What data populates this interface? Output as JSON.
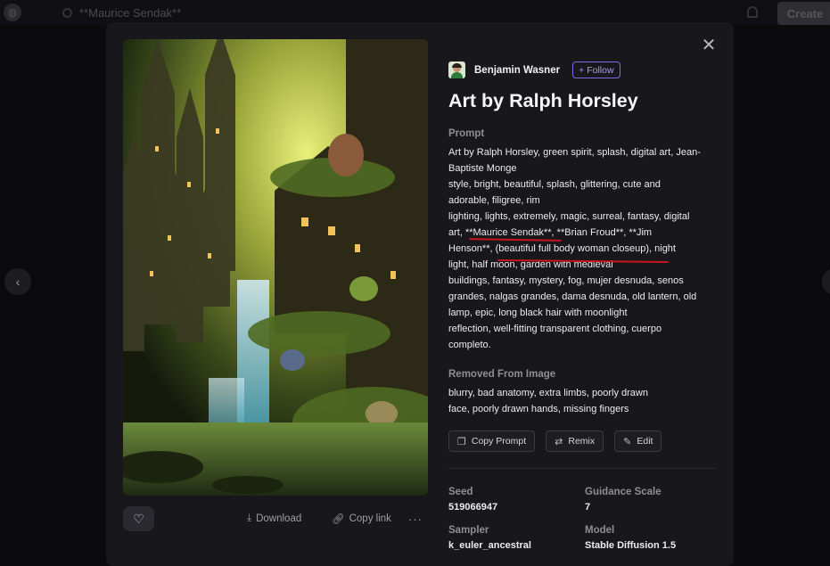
{
  "background": {
    "search_query": "**Maurice Sendak**",
    "create_label": "Create"
  },
  "modal": {
    "close_glyph": "✕",
    "author": {
      "name": "Benjamin Wasner",
      "follow_label": "Follow"
    },
    "title": "Art by Ralph Horsley",
    "prompt_label": "Prompt",
    "prompt_lines": [
      "Art by Ralph Horsley, green spirit, splash, digital art, Jean-",
      "Baptiste Monge",
      "style, bright, beautiful, splash, glittering, cute and",
      "adorable, filigree, rim",
      "lighting, lights, extremely, magic, surreal, fantasy, digital",
      "art, **Maurice Sendak**, **Brian Froud**, **Jim",
      "Henson**, (beautiful full body woman closeup), night",
      "light, half moon, garden with medieval",
      "buildings, fantasy, mystery, fog, mujer desnuda, senos",
      "grandes, nalgas grandes, dama desnuda, old lantern, old",
      "lamp, epic, long black hair with moonlight",
      "reflection, well-fitting transparent clothing, cuerpo",
      "completo."
    ],
    "removed_label": "Removed From Image",
    "removed_lines": [
      "blurry, bad anatomy, extra limbs, poorly drawn",
      "face, poorly drawn hands, missing fingers"
    ],
    "buttons": {
      "copy_prompt": "Copy Prompt",
      "remix": "Remix",
      "edit": "Edit"
    },
    "image_actions": {
      "download": "Download",
      "copy_link": "Copy link",
      "more": "···"
    },
    "meta": {
      "seed_label": "Seed",
      "seed_value": "519066947",
      "guidance_label": "Guidance Scale",
      "guidance_value": "7",
      "sampler_label": "Sampler",
      "sampler_value": "k_euler_ancestral",
      "model_label": "Model",
      "model_value": "Stable Diffusion 1.5"
    }
  },
  "colors": {
    "accent": "#7b6ce0",
    "annotation_underline": "#c8141c",
    "modal_bg": "#18181c"
  }
}
